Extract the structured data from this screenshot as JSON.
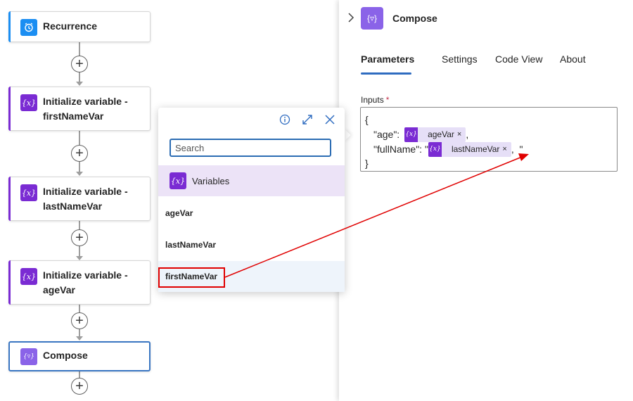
{
  "flow": {
    "cards": [
      {
        "title_lines": [
          "Recurrence"
        ],
        "icon": "clock-icon",
        "color": "#1b8ef2"
      },
      {
        "title_lines": [
          "Initialize variable -",
          "firstNameVar"
        ],
        "icon": "variable-icon",
        "color": "#7a2bd3"
      },
      {
        "title_lines": [
          "Initialize variable -",
          "lastNameVar"
        ],
        "icon": "variable-icon",
        "color": "#7a2bd3"
      },
      {
        "title_lines": [
          "Initialize variable -",
          "ageVar"
        ],
        "icon": "variable-icon",
        "color": "#7a2bd3"
      },
      {
        "title_lines": [
          "Compose"
        ],
        "icon": "compose-icon",
        "color": "#8a63e8"
      }
    ],
    "add_symbol": "+"
  },
  "popup": {
    "search_placeholder": "Search",
    "section_label": "Variables",
    "section_icon": "variable-icon",
    "items": [
      "ageVar",
      "lastNameVar",
      "firstNameVar"
    ],
    "tools": [
      "info-icon",
      "expand-icon",
      "close-icon"
    ]
  },
  "panel": {
    "title": "Compose",
    "icon": "compose-icon",
    "tabs": [
      "Parameters",
      "Settings",
      "Code View",
      "About"
    ],
    "active_tab": "Parameters",
    "inputs_label": "Inputs",
    "required_mark": "*",
    "editor": {
      "open_brace": "{",
      "close_brace": "}",
      "line1_key": "\"age\": ",
      "line1_token": "ageVar",
      "line1_suffix": ",",
      "line2_key": "\"fullName\": \"",
      "line2_token": "lastNameVar",
      "line2_suffix": ",  \"",
      "token_remove": "×"
    }
  },
  "annotation": {
    "color": "#e00000"
  }
}
